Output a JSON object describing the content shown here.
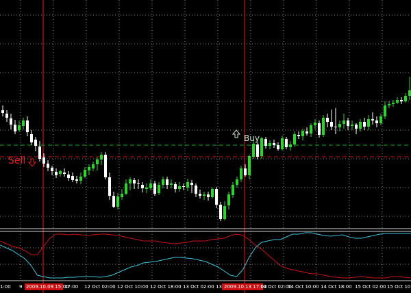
{
  "chart_data": {
    "type": "candlestick",
    "colors": {
      "background": "#000000",
      "bull_candle": "#2bd62b",
      "bear_candle": "#ffffff",
      "grid": "#8a8a8a",
      "signal_line": "#c81414",
      "buy_level": "#1aa51a",
      "sell_level": "#c81414",
      "oscillator_red": "#c81414",
      "oscillator_cyan": "#3ec3d6"
    },
    "signals": [
      {
        "label": "Sell",
        "icon": "sell-arrow-icon",
        "color": "#e02020"
      },
      {
        "label": "Buy",
        "icon": "buy-arrow-icon",
        "color": "#cfe8cf"
      }
    ],
    "x_ticks": [
      "1:00",
      "9",
      "",
      "17:00",
      "12 Oct 02:00",
      "12 Oct 10:00",
      "12 Oct 18:00",
      "13 Oct 02:00",
      "13 Oct 10:00",
      "13",
      "",
      "14 Oct 02:00",
      "14 Oct 10:00",
      "14 Oct 18:00",
      "15 Oct 02:00",
      "15 Oct 10:00"
    ],
    "highlighted_ticks": [
      "2009.10.09 15:00",
      "2009.10.13 17:00"
    ],
    "candles_y": [
      [
        161,
        165,
        154,
        170
      ],
      [
        166,
        172,
        161,
        178
      ],
      [
        173,
        182,
        166,
        189
      ],
      [
        182,
        192,
        175,
        196
      ],
      [
        190,
        183,
        176,
        193
      ],
      [
        184,
        176,
        172,
        189
      ],
      [
        176,
        193,
        170,
        199
      ],
      [
        196,
        208,
        190,
        212
      ],
      [
        204,
        213,
        200,
        221
      ],
      [
        214,
        232,
        206,
        236
      ],
      [
        230,
        239,
        224,
        244
      ],
      [
        239,
        245,
        234,
        250
      ],
      [
        245,
        250,
        242,
        256
      ],
      [
        251,
        256,
        246,
        260
      ],
      [
        254,
        250,
        248,
        258
      ],
      [
        252,
        254,
        246,
        258
      ],
      [
        255,
        260,
        250,
        264
      ],
      [
        257,
        263,
        252,
        266
      ],
      [
        262,
        264,
        257,
        268
      ],
      [
        264,
        258,
        252,
        269
      ],
      [
        258,
        248,
        244,
        260
      ],
      [
        249,
        244,
        240,
        256
      ],
      [
        246,
        240,
        236,
        250
      ],
      [
        240,
        233,
        230,
        249
      ],
      [
        233,
        226,
        222,
        241
      ],
      [
        226,
        259,
        222,
        262
      ],
      [
        259,
        286,
        252,
        292
      ],
      [
        286,
        302,
        280,
        304
      ],
      [
        302,
        287,
        282,
        306
      ],
      [
        288,
        283,
        276,
        292
      ],
      [
        283,
        268,
        262,
        285
      ],
      [
        268,
        262,
        259,
        278
      ],
      [
        263,
        268,
        260,
        276
      ],
      [
        268,
        269,
        262,
        276
      ],
      [
        270,
        275,
        266,
        281
      ],
      [
        276,
        274,
        268,
        282
      ],
      [
        275,
        268,
        262,
        278
      ],
      [
        268,
        283,
        264,
        286
      ],
      [
        282,
        270,
        266,
        285
      ],
      [
        270,
        262,
        258,
        275
      ],
      [
        262,
        270,
        258,
        276
      ],
      [
        270,
        268,
        262,
        275
      ],
      [
        269,
        276,
        266,
        281
      ],
      [
        276,
        272,
        266,
        280
      ],
      [
        272,
        273,
        268,
        278
      ],
      [
        274,
        266,
        261,
        279
      ],
      [
        267,
        270,
        263,
        282
      ],
      [
        271,
        283,
        268,
        288
      ],
      [
        283,
        286,
        277,
        290
      ],
      [
        286,
        284,
        280,
        292
      ],
      [
        284,
        288,
        280,
        293
      ],
      [
        288,
        276,
        274,
        290
      ],
      [
        276,
        299,
        273,
        304
      ],
      [
        299,
        320,
        295,
        323
      ],
      [
        320,
        301,
        294,
        322
      ],
      [
        300,
        284,
        280,
        306
      ],
      [
        285,
        270,
        266,
        289
      ],
      [
        270,
        262,
        258,
        274
      ],
      [
        262,
        246,
        242,
        266
      ],
      [
        246,
        256,
        240,
        258
      ],
      [
        256,
        228,
        226,
        262
      ],
      [
        229,
        210,
        205,
        232
      ],
      [
        211,
        229,
        208,
        233
      ],
      [
        228,
        202,
        200,
        232
      ],
      [
        203,
        213,
        200,
        217
      ],
      [
        213,
        209,
        205,
        218
      ],
      [
        209,
        212,
        204,
        216
      ],
      [
        212,
        218,
        208,
        220
      ],
      [
        218,
        202,
        198,
        220
      ],
      [
        203,
        215,
        200,
        218
      ],
      [
        215,
        211,
        206,
        220
      ],
      [
        211,
        196,
        192,
        214
      ],
      [
        197,
        199,
        192,
        203
      ],
      [
        199,
        191,
        188,
        205
      ],
      [
        192,
        195,
        186,
        198
      ],
      [
        195,
        183,
        180,
        200
      ],
      [
        183,
        179,
        174,
        189
      ],
      [
        180,
        197,
        176,
        201
      ],
      [
        197,
        172,
        168,
        200
      ],
      [
        172,
        178,
        166,
        186
      ],
      [
        178,
        185,
        160,
        190
      ],
      [
        185,
        186,
        158,
        196
      ],
      [
        186,
        181,
        176,
        192
      ],
      [
        181,
        176,
        166,
        188
      ],
      [
        176,
        184,
        172,
        190
      ],
      [
        184,
        182,
        176,
        190
      ],
      [
        182,
        188,
        180,
        196
      ],
      [
        188,
        178,
        174,
        192
      ],
      [
        178,
        185,
        172,
        190
      ],
      [
        185,
        174,
        168,
        190
      ],
      [
        174,
        176,
        164,
        182
      ],
      [
        176,
        180,
        170,
        186
      ],
      [
        180,
        170,
        166,
        183
      ],
      [
        170,
        154,
        148,
        174
      ],
      [
        154,
        152,
        148,
        158
      ],
      [
        152,
        150,
        146,
        156
      ],
      [
        150,
        146,
        142,
        152
      ],
      [
        146,
        148,
        142,
        152
      ],
      [
        148,
        140,
        136,
        150
      ],
      [
        140,
        132,
        112,
        146
      ],
      [
        132,
        96,
        90,
        134
      ],
      [
        97,
        88,
        82,
        100
      ],
      [
        88,
        72,
        64,
        92
      ],
      [
        72,
        56,
        50,
        76
      ]
    ],
    "oscillator": {
      "red": [
        352,
        356,
        360,
        362,
        366,
        372,
        372,
        360,
        348,
        342,
        342,
        343,
        342,
        343,
        344,
        343,
        342,
        342,
        343,
        344,
        346,
        348,
        350,
        352,
        352,
        352,
        354,
        355,
        356,
        355,
        354,
        352,
        352,
        352,
        350,
        349,
        348,
        344,
        342,
        344,
        350,
        358,
        364,
        372,
        380,
        388,
        392,
        394,
        396,
        398,
        400,
        400,
        402,
        404,
        405,
        406,
        406,
        405,
        404,
        405,
        406,
        406,
        406,
        404,
        404,
        405,
        406
      ],
      "cyan": [
        358,
        362,
        366,
        372,
        378,
        388,
        402,
        404,
        406,
        406,
        406,
        405,
        405,
        404,
        404,
        404,
        405,
        404,
        402,
        398,
        394,
        390,
        388,
        384,
        383,
        382,
        380,
        378,
        376,
        376,
        377,
        378,
        380,
        382,
        386,
        390,
        396,
        402,
        404,
        394,
        376,
        362,
        354,
        352,
        350,
        350,
        346,
        342,
        342,
        340,
        340,
        342,
        344,
        345,
        344,
        343,
        346,
        348,
        348,
        346,
        344,
        342,
        341,
        341,
        341,
        341,
        341
      ]
    }
  }
}
